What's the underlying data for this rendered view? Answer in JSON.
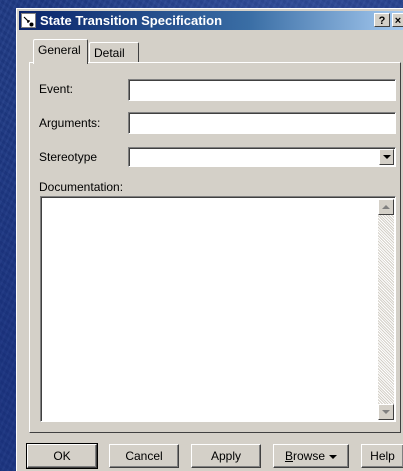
{
  "window": {
    "title": "State Transition Specification",
    "help_button": "?",
    "close_button": "×"
  },
  "tabs": [
    {
      "label": "General",
      "selected": true
    },
    {
      "label": "Detail",
      "selected": false
    }
  ],
  "form": {
    "event_label": "Event:",
    "event_value": "",
    "arguments_label": "Arguments:",
    "arguments_value": "",
    "stereotype_label": "Stereotype",
    "stereotype_value": "",
    "documentation_label": "Documentation:",
    "documentation_value": ""
  },
  "buttons": {
    "ok": "OK",
    "cancel": "Cancel",
    "apply": "Apply",
    "browse_prefix": "B",
    "browse_rest": "rowse",
    "help": "Help"
  }
}
